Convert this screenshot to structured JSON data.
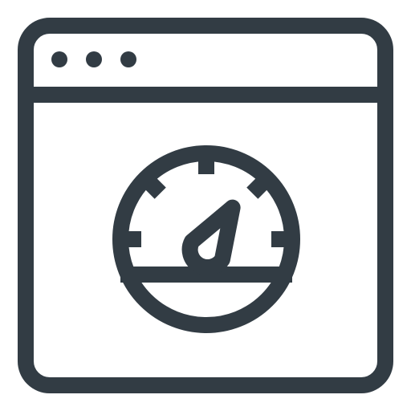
{
  "icon": {
    "name": "browser-window-speed-gauge-icon",
    "stroke_color": "#323c44",
    "background_color": "#ffffff",
    "gauge_level": 0.67
  }
}
